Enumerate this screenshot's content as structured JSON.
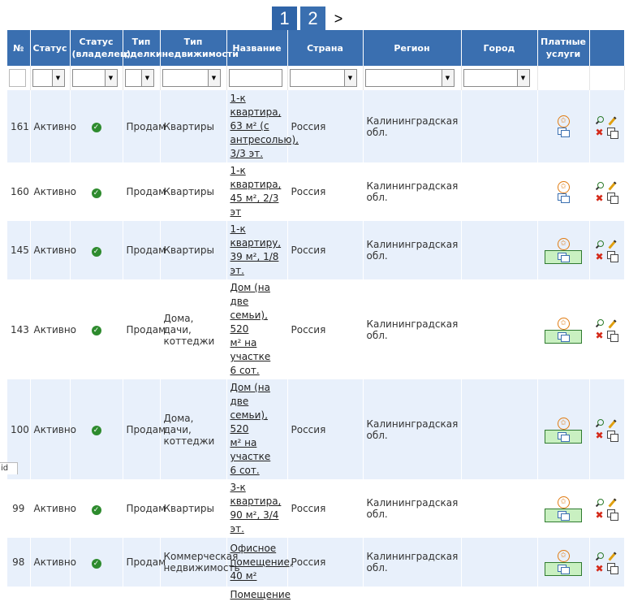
{
  "pagination": {
    "pages": [
      "1",
      "2"
    ],
    "current": "1",
    "next_label": ">"
  },
  "table": {
    "headers": {
      "num": "№",
      "status": "Статус",
      "status_owner": "Статус (владелец)",
      "deal": "Тип сделки",
      "estate": "Тип недвижимости",
      "name": "Название",
      "country": "Страна",
      "region": "Регион",
      "city": "Город",
      "paid": "Платные услуги"
    },
    "rows": [
      {
        "num": "161",
        "status": "Активно",
        "deal": "Продам",
        "estate": "Квартиры",
        "name": [
          "1-к квартира,",
          "63 м² (с",
          "антресолью),",
          "3/3 эт."
        ],
        "country": "Россия",
        "region": "Калининградская обл.",
        "paid_highlight": false
      },
      {
        "num": "160",
        "status": "Активно",
        "deal": "Продам",
        "estate": "Квартиры",
        "name": [
          "1-к квартира,",
          "45 м², 2/3 эт"
        ],
        "country": "Россия",
        "region": "Калининградская обл.",
        "paid_highlight": false
      },
      {
        "num": "145",
        "status": "Активно",
        "deal": "Продам",
        "estate": "Квартиры",
        "name": [
          "1-к квартиру,",
          "39 м², 1/8 эт."
        ],
        "country": "Россия",
        "region": "Калининградская обл.",
        "paid_highlight": true
      },
      {
        "num": "143",
        "status": "Активно",
        "deal": "Продам",
        "estate": [
          "Дома, дачи,",
          "коттеджи"
        ],
        "name": [
          "Дом (на две",
          "семьи), 520",
          "м² на участке",
          "6 сот."
        ],
        "country": "Россия",
        "region": "Калининградская обл.",
        "paid_highlight": true
      },
      {
        "num": "100",
        "status": "Активно",
        "deal": "Продам",
        "estate": [
          "Дома, дачи,",
          "коттеджи"
        ],
        "name": [
          "Дом (на две",
          "семьи), 520",
          "м² на участке",
          "6 сот."
        ],
        "country": "Россия",
        "region": "Калининградская обл.",
        "paid_highlight": true
      },
      {
        "num": "99",
        "status": "Активно",
        "deal": "Продам",
        "estate": "Квартиры",
        "name": [
          "3-к квартира,",
          "90 м², 3/4 эт."
        ],
        "country": "Россия",
        "region": "Калининградская обл.",
        "paid_highlight": true
      },
      {
        "num": "98",
        "status": "Активно",
        "deal": "Продам",
        "estate": [
          "Коммерческая",
          "недвижимость"
        ],
        "name": [
          "Офисное",
          "помещение,",
          "40 м²"
        ],
        "country": "Россия",
        "region": "Калининградская обл.",
        "paid_highlight": true
      }
    ],
    "partial_row_name": "Помещение"
  },
  "corner_label": "id",
  "icons": {
    "ok": "check-circle-icon",
    "star": "star-circle-icon",
    "dup": "duplicate-icon",
    "view": "magnifier-icon",
    "edit": "pencil-icon",
    "delete": "delete-x-icon",
    "copy": "copy-icon"
  }
}
